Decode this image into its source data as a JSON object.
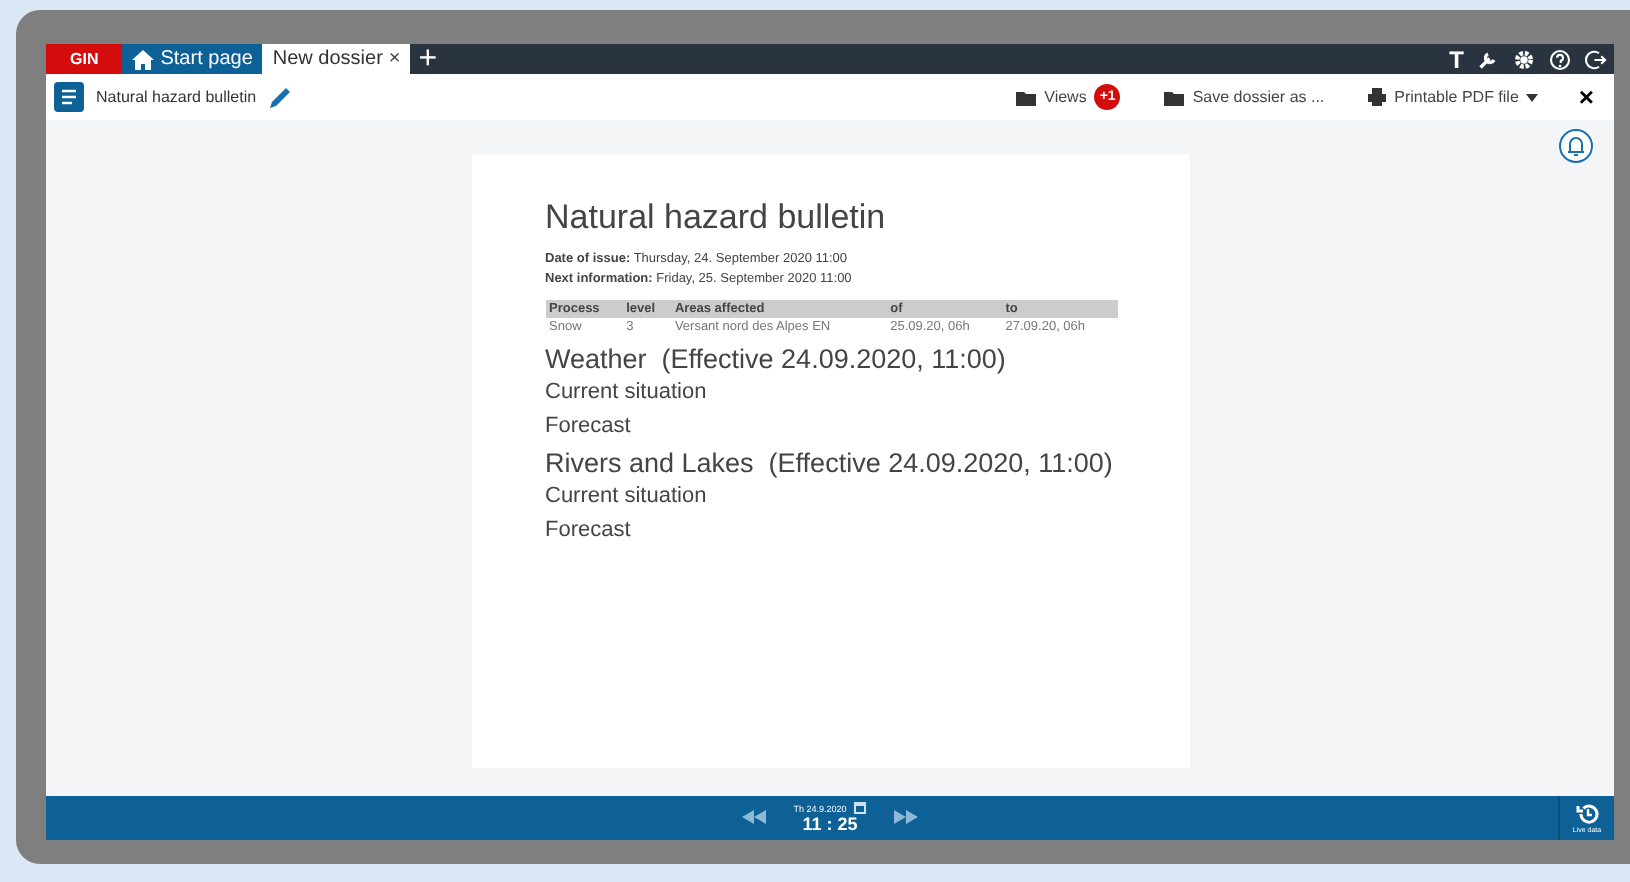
{
  "tabs": [
    {
      "label": "GIN",
      "kind": "logo",
      "selected": false
    },
    {
      "label": "Start page",
      "kind": "home",
      "selected": false
    },
    {
      "label": "New dossier",
      "kind": "doc",
      "selected": true,
      "close": "×"
    }
  ],
  "add_tab": "+",
  "top_icons": [
    {
      "kind": "text",
      "label": "T"
    },
    {
      "kind": "wrench"
    },
    {
      "kind": "gear"
    },
    {
      "kind": "help"
    },
    {
      "kind": "logout"
    }
  ],
  "toolbar": {
    "title": "Natural hazard bulletin",
    "views": "Views",
    "views_badge": "+1",
    "save": "Save dossier as ...",
    "print": "Printable PDF file",
    "close": "×"
  },
  "document": {
    "title": "Natural hazard bulletin",
    "meta": [
      "**Date of issue:** Thursday, 24. September 2020 11:00",
      "**Next information:** Friday, 25. September 2020 11:00"
    ],
    "table": {
      "columns": [
        "Process",
        "level",
        "Areas affected",
        "of",
        "to"
      ],
      "rows": [
        [
          "Snow",
          "3",
          "Versant nord des Alpes EN",
          "25.09.20, 06h",
          "27.09.20, 06h"
        ]
      ]
    },
    "sections": [
      {
        "heading": "Weather  (Effective 24.09.2020, 11:00)",
        "items": [
          "Current situation",
          "Forecast"
        ]
      },
      {
        "heading": "Rivers and Lakes  (Effective 24.09.2020, 11:00)",
        "items": [
          "Current situation",
          "Forecast"
        ]
      }
    ]
  },
  "timebar": {
    "date": "Th 24.9.2020",
    "time": "11 : 25",
    "live": "Live data"
  }
}
